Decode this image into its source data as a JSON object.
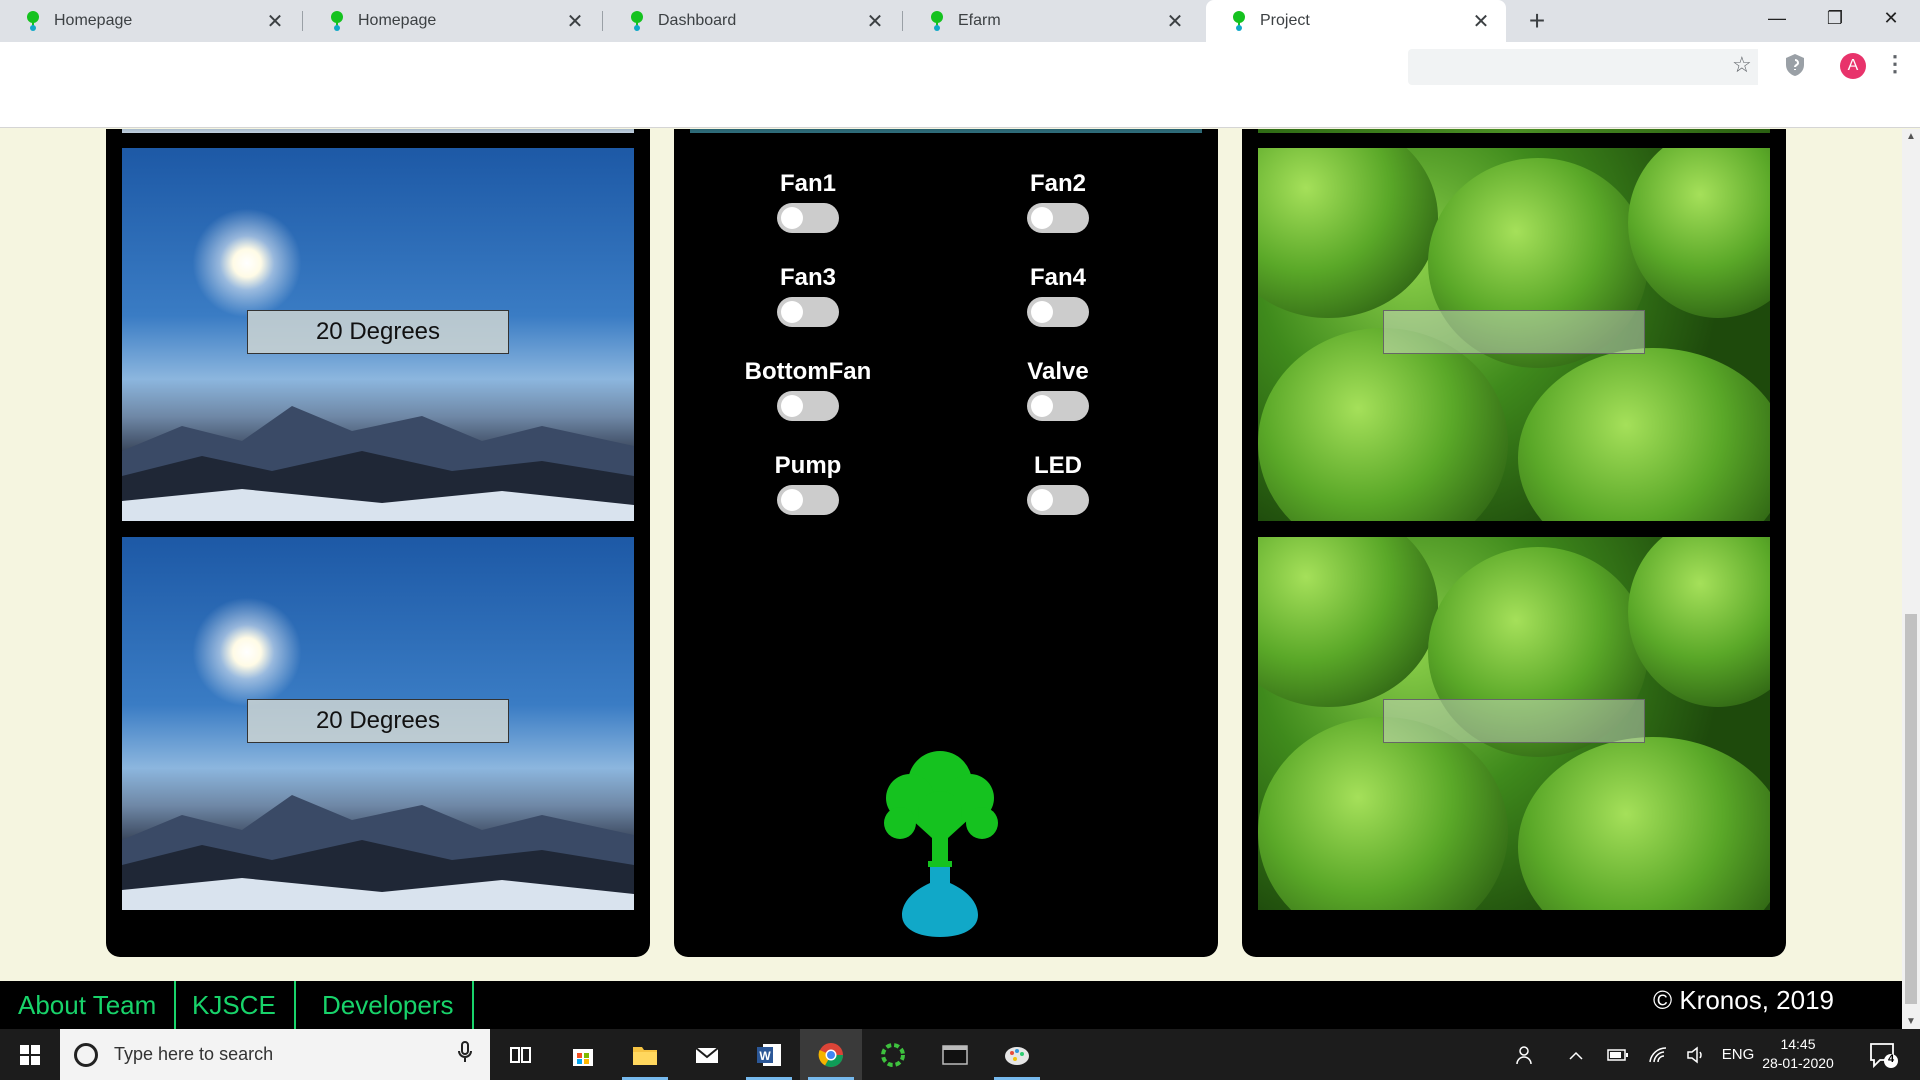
{
  "browser": {
    "tabs": [
      {
        "label": "Homepage"
      },
      {
        "label": "Homepage"
      },
      {
        "label": "Dashboard"
      },
      {
        "label": "Efarm"
      },
      {
        "label": "Project"
      }
    ],
    "new_tab": "+",
    "close_glyph": "✕",
    "window": {
      "minimize": "—",
      "restore": "❐",
      "close": "✕"
    },
    "address": "",
    "profile_initial": "A",
    "star_icon": "☆",
    "menu_icon": "⋮"
  },
  "dashboard": {
    "temperature_cards": [
      {
        "value": "20 Degrees"
      },
      {
        "value": "20 Degrees"
      }
    ],
    "humidity_cards": [
      {
        "value": ""
      },
      {
        "value": ""
      }
    ],
    "controls": [
      {
        "label": "Fan1",
        "on": false
      },
      {
        "label": "Fan2",
        "on": false
      },
      {
        "label": "Fan3",
        "on": false
      },
      {
        "label": "Fan4",
        "on": false
      },
      {
        "label": "BottomFan",
        "on": false
      },
      {
        "label": "Valve",
        "on": false
      },
      {
        "label": "Pump",
        "on": false
      },
      {
        "label": "LED",
        "on": false
      }
    ],
    "logo_colors": {
      "tree": "#15c21f",
      "flask": "#11a8c8"
    }
  },
  "footer": {
    "links": [
      "About Team",
      "KJSCE",
      "Developers"
    ],
    "copyright": "© Kronos, 2019",
    "link_color": "#18d36a"
  },
  "taskbar": {
    "search_placeholder": "Type here to search",
    "language": "ENG",
    "time": "14:45",
    "date": "28-01-2020",
    "notification_count": "4"
  }
}
